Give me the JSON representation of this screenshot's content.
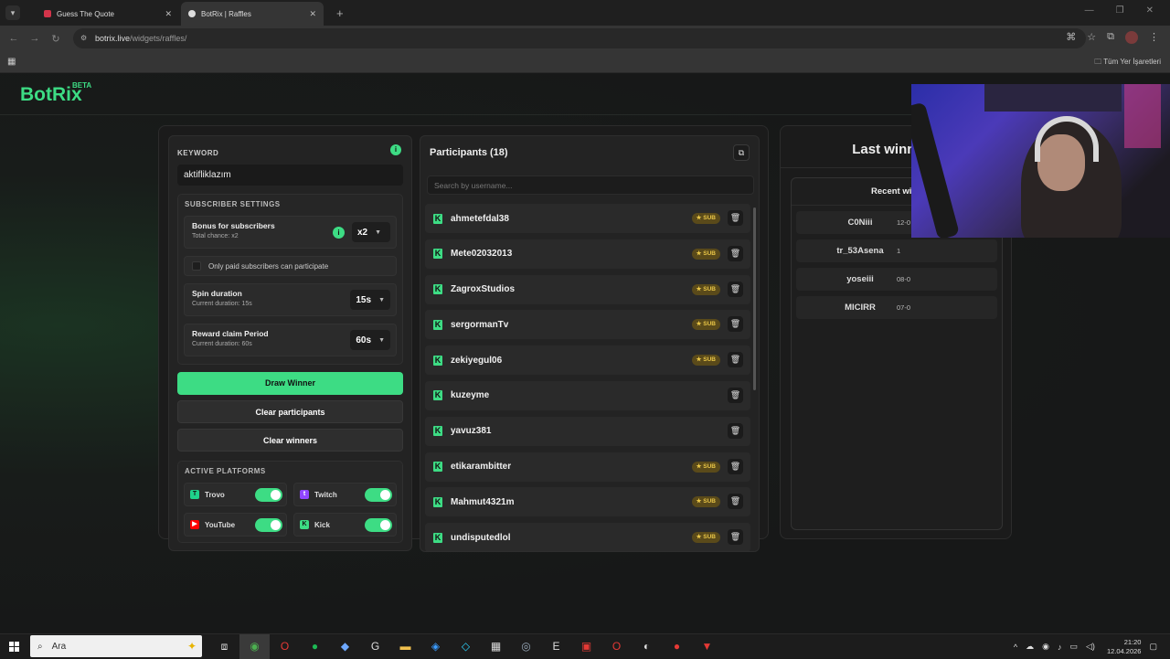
{
  "browser": {
    "tabs": [
      {
        "title": "Guess The Quote",
        "active": false
      },
      {
        "title": "BotRix | Raffles",
        "active": true
      }
    ],
    "url_host": "botrix.live",
    "url_path": "/widgets/raffles/",
    "bookmarks_label": "Tüm Yer İşaretleri"
  },
  "app": {
    "logo": "BotRix",
    "logo_badge": "BETA"
  },
  "settings": {
    "keyword_label": "KEYWORD",
    "keyword_value": "aktifliklazım",
    "subscriber_title": "SUBSCRIBER SETTINGS",
    "bonus_title": "Bonus for subscribers",
    "bonus_sub": "Total chance: x2",
    "bonus_value": "x2",
    "paid_only_label": "Only paid subscribers can participate",
    "paid_only_checked": false,
    "spin_title": "Spin duration",
    "spin_sub": "Current duration: 15s",
    "spin_value": "15s",
    "claim_title": "Reward claim Period",
    "claim_sub": "Current duration: 60s",
    "claim_value": "60s",
    "draw_label": "Draw Winner",
    "clear_participants_label": "Clear participants",
    "clear_winners_label": "Clear winners",
    "platforms_title": "ACTIVE PLATFORMS",
    "platforms": [
      {
        "name": "Trovo",
        "enabled": true,
        "color": "#1fd18b"
      },
      {
        "name": "Twitch",
        "enabled": true,
        "color": "#9146ff"
      },
      {
        "name": "YouTube",
        "enabled": true,
        "color": "#ff0000"
      },
      {
        "name": "Kick",
        "enabled": true,
        "color": "#3ddc84"
      }
    ]
  },
  "participants": {
    "title": "Participants (18)",
    "search_placeholder": "Search by username...",
    "sub_badge": "SUB",
    "items": [
      {
        "name": "ahmetefdal38",
        "sub": true
      },
      {
        "name": "Mete02032013",
        "sub": true
      },
      {
        "name": "ZagroxStudios",
        "sub": true
      },
      {
        "name": "sergormanTv",
        "sub": true
      },
      {
        "name": "zekiyegul06",
        "sub": true
      },
      {
        "name": "kuzeyme",
        "sub": false
      },
      {
        "name": "yavuz381",
        "sub": false
      },
      {
        "name": "etikarambitter",
        "sub": true
      },
      {
        "name": "Mahmut4321m",
        "sub": true
      },
      {
        "name": "undisputedlol",
        "sub": true
      }
    ]
  },
  "winners": {
    "last_winner": "Last winner: -",
    "recent_title": "Recent winn",
    "items": [
      {
        "name": "C0Niii",
        "date": "12-0"
      },
      {
        "name": "tr_53Asena",
        "date": "1"
      },
      {
        "name": "yoseiii",
        "date": "08-0"
      },
      {
        "name": "MICIRR",
        "date": "07-0"
      }
    ]
  },
  "taskbar": {
    "search_placeholder": "Ara",
    "time": "21:20",
    "date": "12.04.2026"
  },
  "colors": {
    "accent": "#3ddc84",
    "sub_badge": "#e8c547"
  }
}
